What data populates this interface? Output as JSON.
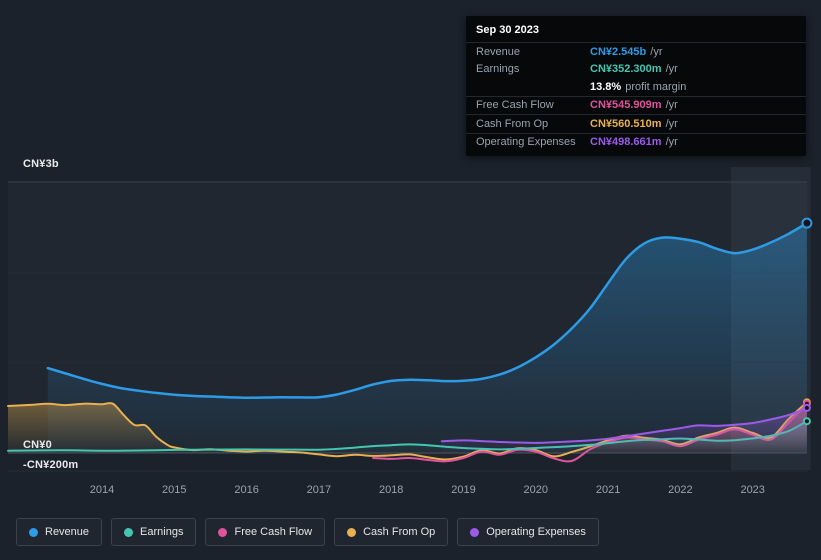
{
  "tooltip": {
    "date": "Sep 30 2023",
    "rows": [
      {
        "key": "revenue",
        "label": "Revenue",
        "value": "CN¥2.545b",
        "suffix": "/yr",
        "color": "#2e9be6",
        "separator": false
      },
      {
        "key": "earnings",
        "label": "Earnings",
        "value": "CN¥352.300m",
        "suffix": "/yr",
        "color": "#45c6b1",
        "separator": false
      },
      {
        "key": "profit-margin",
        "label": "",
        "value": "13.8%",
        "suffix": "profit margin",
        "color": "#ffffff",
        "separator": false
      },
      {
        "key": "free-cash-flow",
        "label": "Free Cash Flow",
        "value": "CN¥545.909m",
        "suffix": "/yr",
        "color": "#e0549d",
        "separator": true
      },
      {
        "key": "cash-from-op",
        "label": "Cash From Op",
        "value": "CN¥560.510m",
        "suffix": "/yr",
        "color": "#e8b04e",
        "separator": true
      },
      {
        "key": "operating-expenses",
        "label": "Operating Expenses",
        "value": "CN¥498.661m",
        "suffix": "/yr",
        "color": "#9a5ce8",
        "separator": true
      }
    ]
  },
  "legend": [
    {
      "key": "revenue",
      "label": "Revenue",
      "color": "#2e9be6"
    },
    {
      "key": "earnings",
      "label": "Earnings",
      "color": "#45c6b1"
    },
    {
      "key": "free-cash-flow",
      "label": "Free Cash Flow",
      "color": "#e0549d"
    },
    {
      "key": "cash-from-op",
      "label": "Cash From Op",
      "color": "#e8b04e"
    },
    {
      "key": "operating-expenses",
      "label": "Operating Expenses",
      "color": "#9a5ce8"
    }
  ],
  "chart_data": {
    "type": "area",
    "title": "",
    "xlabel": "",
    "ylabel": "CN¥",
    "unit": "CN¥ millions per year",
    "x_ticks": [
      2014,
      2015,
      2016,
      2017,
      2018,
      2019,
      2020,
      2021,
      2022,
      2023
    ],
    "xlim": [
      2012.7,
      2023.8
    ],
    "ylim_m": [
      -280,
      3100
    ],
    "y_axis": {
      "labels": [
        "CN¥3b",
        "CN¥0",
        "-CN¥200m"
      ],
      "values_m": [
        3000,
        0,
        -200
      ]
    },
    "grid_values_m": [
      3000,
      2000,
      1000,
      0,
      -200
    ],
    "highlight_x_range": [
      2022.7,
      2023.8
    ],
    "legend_position": "bottom",
    "latest": {
      "date": "Sep 30 2023",
      "revenue_m": 2545,
      "earnings_m": 352.3,
      "profit_margin_pct": 13.8,
      "free_cash_flow_m": 545.909,
      "cash_from_op_m": 560.51,
      "operating_expenses_m": 498.661
    },
    "series": [
      {
        "id": "revenue",
        "name": "Revenue",
        "color": "#2e9be6",
        "fill_opacity": 0.38,
        "points": [
          [
            2013.25,
            940
          ],
          [
            2013.5,
            880
          ],
          [
            2013.75,
            820
          ],
          [
            2014,
            765
          ],
          [
            2014.25,
            720
          ],
          [
            2014.5,
            690
          ],
          [
            2014.75,
            665
          ],
          [
            2015,
            645
          ],
          [
            2015.25,
            632
          ],
          [
            2015.5,
            625
          ],
          [
            2015.75,
            618
          ],
          [
            2016,
            612
          ],
          [
            2016.25,
            614
          ],
          [
            2016.5,
            617
          ],
          [
            2016.75,
            615
          ],
          [
            2017,
            618
          ],
          [
            2017.25,
            648
          ],
          [
            2017.5,
            700
          ],
          [
            2017.75,
            758
          ],
          [
            2018,
            798
          ],
          [
            2018.25,
            810
          ],
          [
            2018.5,
            806
          ],
          [
            2018.75,
            796
          ],
          [
            2019,
            800
          ],
          [
            2019.25,
            820
          ],
          [
            2019.5,
            868
          ],
          [
            2019.75,
            948
          ],
          [
            2020,
            1060
          ],
          [
            2020.25,
            1200
          ],
          [
            2020.5,
            1380
          ],
          [
            2020.75,
            1600
          ],
          [
            2021,
            1880
          ],
          [
            2021.25,
            2150
          ],
          [
            2021.5,
            2320
          ],
          [
            2021.75,
            2385
          ],
          [
            2022,
            2372
          ],
          [
            2022.25,
            2335
          ],
          [
            2022.5,
            2262
          ],
          [
            2022.75,
            2212
          ],
          [
            2023,
            2252
          ],
          [
            2023.25,
            2330
          ],
          [
            2023.5,
            2428
          ],
          [
            2023.75,
            2545
          ]
        ]
      },
      {
        "id": "cash-from-op",
        "name": "Cash From Op",
        "color": "#e8b04e",
        "fill_opacity": 0.4,
        "points": [
          [
            2012.7,
            520
          ],
          [
            2013,
            532
          ],
          [
            2013.25,
            545
          ],
          [
            2013.5,
            530
          ],
          [
            2013.75,
            546
          ],
          [
            2014,
            540
          ],
          [
            2014.15,
            546
          ],
          [
            2014.3,
            420
          ],
          [
            2014.45,
            310
          ],
          [
            2014.6,
            305
          ],
          [
            2014.75,
            180
          ],
          [
            2014.9,
            92
          ],
          [
            2015,
            62
          ],
          [
            2015.25,
            32
          ],
          [
            2015.5,
            42
          ],
          [
            2015.75,
            26
          ],
          [
            2016,
            16
          ],
          [
            2016.25,
            26
          ],
          [
            2016.5,
            15
          ],
          [
            2016.75,
            5
          ],
          [
            2017,
            -15
          ],
          [
            2017.25,
            -35
          ],
          [
            2017.5,
            -20
          ],
          [
            2017.75,
            -32
          ],
          [
            2018,
            -26
          ],
          [
            2018.25,
            -16
          ],
          [
            2018.5,
            -46
          ],
          [
            2018.75,
            -72
          ],
          [
            2019,
            -40
          ],
          [
            2019.25,
            30
          ],
          [
            2019.5,
            -5
          ],
          [
            2019.75,
            52
          ],
          [
            2020,
            32
          ],
          [
            2020.25,
            -38
          ],
          [
            2020.5,
            12
          ],
          [
            2020.75,
            72
          ],
          [
            2021,
            142
          ],
          [
            2021.25,
            192
          ],
          [
            2021.5,
            168
          ],
          [
            2021.75,
            146
          ],
          [
            2022,
            96
          ],
          [
            2022.25,
            172
          ],
          [
            2022.5,
            222
          ],
          [
            2022.75,
            282
          ],
          [
            2023,
            222
          ],
          [
            2023.25,
            172
          ],
          [
            2023.5,
            380
          ],
          [
            2023.75,
            560
          ]
        ]
      },
      {
        "id": "free-cash-flow",
        "name": "Free Cash Flow",
        "color": "#e0549d",
        "fill_opacity": 0.35,
        "points": [
          [
            2017.75,
            -55
          ],
          [
            2018,
            -65
          ],
          [
            2018.25,
            -55
          ],
          [
            2018.5,
            -76
          ],
          [
            2018.75,
            -92
          ],
          [
            2019,
            -55
          ],
          [
            2019.25,
            15
          ],
          [
            2019.5,
            -20
          ],
          [
            2019.75,
            36
          ],
          [
            2020,
            15
          ],
          [
            2020.25,
            -60
          ],
          [
            2020.5,
            -88
          ],
          [
            2020.75,
            40
          ],
          [
            2021,
            120
          ],
          [
            2021.25,
            172
          ],
          [
            2021.5,
            150
          ],
          [
            2021.75,
            130
          ],
          [
            2022,
            75
          ],
          [
            2022.25,
            150
          ],
          [
            2022.5,
            202
          ],
          [
            2022.75,
            262
          ],
          [
            2023,
            202
          ],
          [
            2023.25,
            150
          ],
          [
            2023.5,
            340
          ],
          [
            2023.75,
            546
          ]
        ]
      },
      {
        "id": "earnings",
        "name": "Earnings",
        "color": "#45c6b1",
        "fill_opacity": 0.28,
        "points": [
          [
            2012.7,
            25
          ],
          [
            2013,
            28
          ],
          [
            2013.5,
            30
          ],
          [
            2014,
            25
          ],
          [
            2014.5,
            28
          ],
          [
            2015,
            34
          ],
          [
            2015.5,
            38
          ],
          [
            2016,
            40
          ],
          [
            2016.5,
            38
          ],
          [
            2017,
            36
          ],
          [
            2017.25,
            45
          ],
          [
            2017.5,
            60
          ],
          [
            2017.75,
            76
          ],
          [
            2018,
            86
          ],
          [
            2018.25,
            95
          ],
          [
            2018.5,
            86
          ],
          [
            2018.75,
            70
          ],
          [
            2019,
            55
          ],
          [
            2019.25,
            46
          ],
          [
            2019.5,
            40
          ],
          [
            2019.75,
            46
          ],
          [
            2020,
            55
          ],
          [
            2020.25,
            65
          ],
          [
            2020.5,
            76
          ],
          [
            2020.75,
            90
          ],
          [
            2021,
            110
          ],
          [
            2021.25,
            130
          ],
          [
            2021.5,
            145
          ],
          [
            2021.75,
            152
          ],
          [
            2022,
            160
          ],
          [
            2022.25,
            150
          ],
          [
            2022.5,
            136
          ],
          [
            2022.75,
            142
          ],
          [
            2023,
            162
          ],
          [
            2023.25,
            192
          ],
          [
            2023.5,
            245
          ],
          [
            2023.75,
            352
          ]
        ]
      },
      {
        "id": "operating-expenses",
        "name": "Operating Expenses",
        "color": "#9a5ce8",
        "fill_opacity": 0.35,
        "points": [
          [
            2018.7,
            130
          ],
          [
            2019,
            140
          ],
          [
            2019.25,
            132
          ],
          [
            2019.5,
            122
          ],
          [
            2019.75,
            116
          ],
          [
            2020,
            112
          ],
          [
            2020.25,
            118
          ],
          [
            2020.5,
            128
          ],
          [
            2020.75,
            140
          ],
          [
            2021,
            158
          ],
          [
            2021.25,
            186
          ],
          [
            2021.5,
            216
          ],
          [
            2021.75,
            246
          ],
          [
            2022,
            276
          ],
          [
            2022.25,
            306
          ],
          [
            2022.5,
            300
          ],
          [
            2022.75,
            312
          ],
          [
            2023,
            332
          ],
          [
            2023.25,
            372
          ],
          [
            2023.5,
            422
          ],
          [
            2023.75,
            499
          ]
        ]
      }
    ]
  }
}
